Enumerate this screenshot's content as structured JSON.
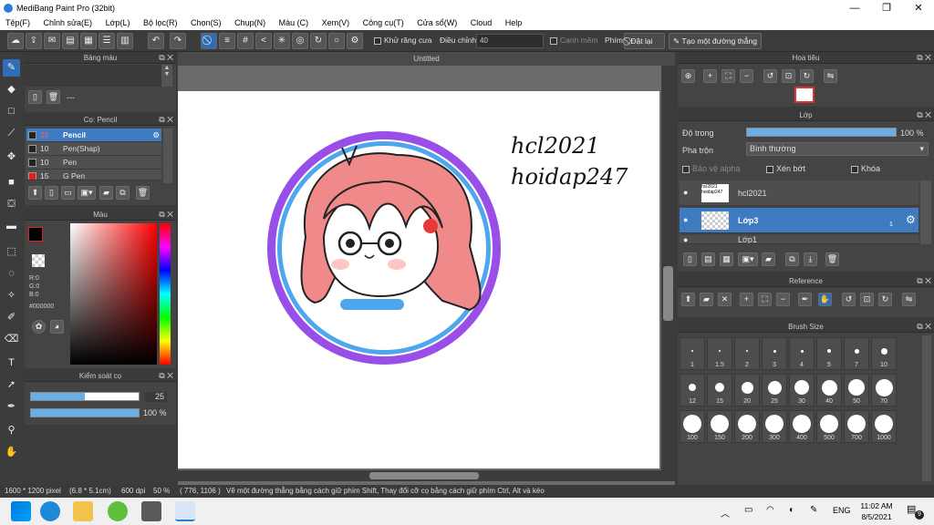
{
  "window": {
    "title": "MediBang Paint Pro (32bit)",
    "minimize": "—",
    "maximize": "❐",
    "close": "✕"
  },
  "menu": [
    "Tệp(F)",
    "Chỉnh sửa(E)",
    "Lớp(L)",
    "Bộ lọc(R)",
    "Chọn(S)",
    "Chụp(N)",
    "Màu (C)",
    "Xem(V)",
    "Công cụ(T)",
    "Cửa sổ(W)",
    "Cloud",
    "Help"
  ],
  "toolbar": {
    "antialias_label": "Khử răng cưa",
    "adjust_label": "Điều chỉnh",
    "adjust_value": "40",
    "edge_label": "Cạnh mềm",
    "key_label": "Phím",
    "reset_label": "Đặt lại",
    "line_label": "Tạo một đường thẳng"
  },
  "color_palette": {
    "title": "Bảng màu",
    "dash": "---"
  },
  "brush_panel": {
    "title": "Cọ: Pencil",
    "brushes": [
      {
        "size": "25",
        "name": "Pencil",
        "color": "#222222"
      },
      {
        "size": "10",
        "name": "Pen(Shap)",
        "color": "#222222"
      },
      {
        "size": "10",
        "name": "Pen",
        "color": "#222222"
      },
      {
        "size": "15",
        "name": "G Pen",
        "color": "#e02020"
      }
    ]
  },
  "color_panel": {
    "title": "Màu",
    "r": "R:0",
    "g": "G:0",
    "b": "B:0",
    "hex": "#000000"
  },
  "brush_control": {
    "title": "Kiểm soát cọ",
    "size": "25",
    "opacity": "100 %",
    "size_fraction": 0.5,
    "opacity_fraction": 1.0
  },
  "canvas": {
    "tab": "Untitled",
    "text1": "hcl2021",
    "text2": "hoidap247"
  },
  "navigator": {
    "title": "Hoa tiêu"
  },
  "layer_panel": {
    "title": "Lớp",
    "opacity_label": "Độ trong",
    "opacity_value": "100 %",
    "blend_label": "Pha trộn",
    "blend_value": "Bình thường",
    "protect_alpha": "Bảo vệ alpha",
    "clipping": "Xén bớt",
    "lock": "Khóa",
    "layers": [
      {
        "name": "hcl2021",
        "thumb": "hcl2021 hoidap247",
        "selected": false
      },
      {
        "name": "Lớp3",
        "thumb": "",
        "selected": true,
        "badge": "1"
      },
      {
        "name": "Lớp1",
        "thumb": "",
        "selected": false
      }
    ]
  },
  "reference": {
    "title": "Reference"
  },
  "brush_size": {
    "title": "Brush Size",
    "sizes": [
      "1",
      "1.5",
      "2",
      "3",
      "4",
      "5",
      "7",
      "10",
      "12",
      "15",
      "20",
      "25",
      "30",
      "40",
      "50",
      "70",
      "100",
      "150",
      "200",
      "300",
      "400",
      "500",
      "700",
      "1000"
    ]
  },
  "status": {
    "dims": "1600 * 1200 pixel",
    "cm": "(6.8 * 5.1cm)",
    "dpi": "600 dpi",
    "zoom": "50 %",
    "coords": "( 776, 1106 )",
    "hint": "Vẽ một đường thẳng bằng cách giữ phím Shift, Thay đổi cỡ cọ bằng cách giữ phím Ctrl, Alt và kéo"
  },
  "taskbar": {
    "lang": "ENG",
    "time": "11:02 AM",
    "date": "8/5/2021",
    "notif": "9"
  },
  "colors": {
    "accent": "#3f7bc0",
    "ring_outer": "#9a4ee8",
    "ring_inner": "#4da6ee",
    "hair": "#f08a8a"
  }
}
